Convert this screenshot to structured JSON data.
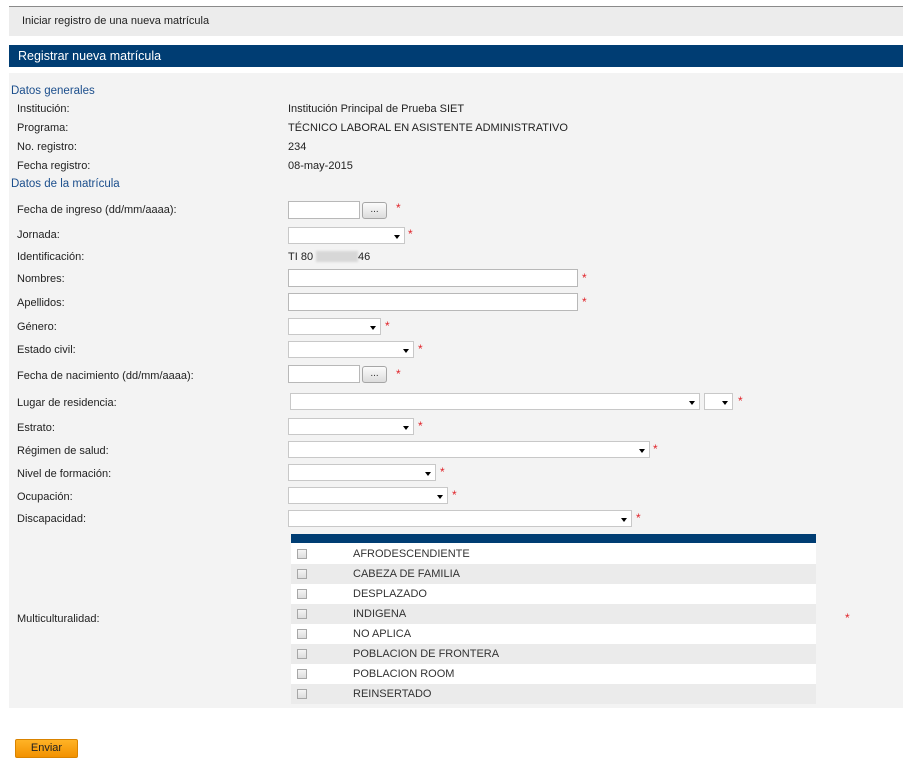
{
  "topbar": {
    "title": "Iniciar registro de una nueva matrícula"
  },
  "panel": {
    "title": "Registrar nueva matrícula"
  },
  "datos_generales": {
    "section_title": "Datos generales",
    "institucion_label": "Institución:",
    "institucion_value": "Institución Principal de Prueba SIET",
    "programa_label": "Programa:",
    "programa_value": "TÉCNICO LABORAL EN ASISTENTE ADMINISTRATIVO",
    "registro_label": "No. registro:",
    "registro_value": "234",
    "fecha_label": "Fecha registro:",
    "fecha_value": "08-may-2015"
  },
  "datos_matricula": {
    "section_title": "Datos de la matrícula",
    "fecha_ingreso_label": "Fecha de ingreso (dd/mm/aaaa):",
    "jornada_label": "Jornada:",
    "identificacion_label": "Identificación:",
    "identificacion_prefix": "TI 80",
    "identificacion_suffix": "46",
    "nombres_label": "Nombres:",
    "apellidos_label": "Apellidos:",
    "genero_label": "Género:",
    "estado_civil_label": "Estado civil:",
    "fecha_nacimiento_label": "Fecha de nacimiento (dd/mm/aaaa):",
    "lugar_residencia_label": "Lugar de residencia:",
    "estrato_label": "Estrato:",
    "regimen_salud_label": "Régimen de salud:",
    "nivel_formacion_label": "Nivel de formación:",
    "ocupacion_label": "Ocupación:",
    "discapacidad_label": "Discapacidad:",
    "multiculturalidad_label": "Multiculturalidad:",
    "date_button_label": "...",
    "required_mark": "*"
  },
  "multiculturalidad_options": [
    "AFRODESCENDIENTE",
    "CABEZA DE FAMILIA",
    "DESPLAZADO",
    "INDIGENA",
    "NO APLICA",
    "POBLACION DE FRONTERA",
    "POBLACION ROOM",
    "REINSERTADO"
  ],
  "actions": {
    "submit_label": "Enviar"
  },
  "colors": {
    "header_bg": "#003d73",
    "section_text": "#1b4e8c",
    "required": "#e0242a",
    "submit_bg": "#f29100"
  }
}
